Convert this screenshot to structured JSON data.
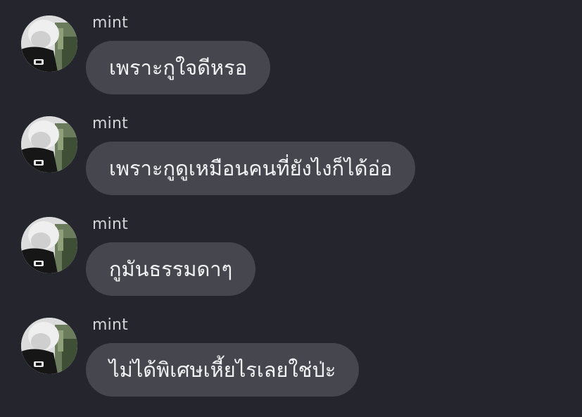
{
  "conversation": {
    "messages": [
      {
        "sender": "mint",
        "text": "เพราะกูใจดีหรอ",
        "avatar_icon": "profile-photo"
      },
      {
        "sender": "mint",
        "text": "เพราะกูดูเหมือนคนที่ยังไงก็ได้อ่อ",
        "avatar_icon": "profile-photo"
      },
      {
        "sender": "mint",
        "text": "กูมันธรรมดาๆ",
        "avatar_icon": "profile-photo"
      },
      {
        "sender": "mint",
        "text": "ไม่ได้พิเศษเหี้ยไรเลยใช่ป่ะ",
        "avatar_icon": "profile-photo"
      }
    ]
  },
  "colors": {
    "background": "#25252d",
    "bubble": "#46464f",
    "bubble_text": "#f2f2f4",
    "sender_text": "#d4d4d8"
  }
}
